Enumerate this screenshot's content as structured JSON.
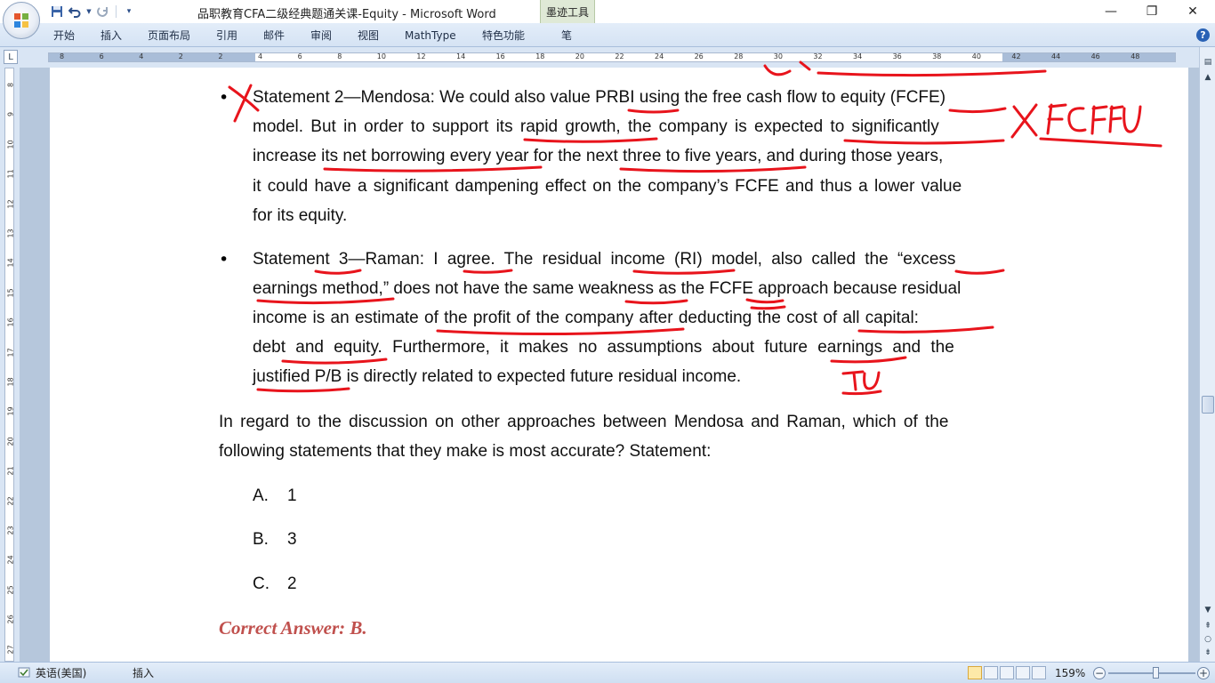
{
  "window": {
    "title": "品职教育CFA二级经典题通关课-Equity - Microsoft Word",
    "context_tab": "墨迹工具",
    "minimize": "—",
    "restore": "❐",
    "close": "✕"
  },
  "qat": {
    "save_icon": "save-icon",
    "undo_icon": "undo-icon",
    "redo_icon": "redo-icon",
    "customize_icon": "customize-icon"
  },
  "ribbon": {
    "tabs": [
      "开始",
      "插入",
      "页面布局",
      "引用",
      "邮件",
      "审阅",
      "视图",
      "MathType",
      "特色功能",
      "笔"
    ],
    "help": "?"
  },
  "ruler": {
    "corner": "L",
    "h_numbers": [
      "8",
      "6",
      "4",
      "2",
      "2",
      "4",
      "6",
      "8",
      "10",
      "12",
      "14",
      "16",
      "18",
      "20",
      "22",
      "24",
      "26",
      "28",
      "30",
      "32",
      "34",
      "36",
      "38",
      "40",
      "42",
      "44",
      "46",
      "48"
    ],
    "v_numbers": [
      "8",
      "9",
      "10",
      "11",
      "12",
      "13",
      "14",
      "15",
      "16",
      "17",
      "18",
      "19",
      "20",
      "21",
      "22",
      "23",
      "24",
      "25",
      "26",
      "27"
    ]
  },
  "document": {
    "statement2_lines": [
      "Statement 2—Mendosa: We could also value PRBI using the free cash flow to equity (FCFE)",
      "model. But in order to support its rapid growth, the company is expected to significantly",
      "increase its net borrowing every year for the next three to five years, and during those years,",
      "it could have a significant dampening effect on the company’s FCFE and thus a lower value",
      "for its equity."
    ],
    "statement3_lines": [
      "Statement 3—Raman: I agree. The residual income (RI) model, also called the “excess",
      "earnings method,” does not have the same weakness as the FCFE approach because residual",
      "income is an estimate of the profit of the company after deducting the cost of all capital:",
      "debt and equity. Furthermore, it makes no assumptions about future earnings and the",
      "justified P/B is directly related to expected future residual income."
    ],
    "question_lines": [
      "In regard to the discussion on other approaches between Mendosa and Raman, which of the",
      "following statements that they make is most accurate? Statement:"
    ],
    "options": [
      {
        "letter": "A.",
        "value": "1"
      },
      {
        "letter": "B.",
        "value": "3"
      },
      {
        "letter": "C.",
        "value": "2"
      }
    ],
    "answer": "Correct Answer: B.",
    "bullet": "•",
    "ink_annotations": [
      "FCFFU",
      "TU"
    ]
  },
  "statusbar": {
    "language": "英语(美国)",
    "insert_mode": "插入",
    "zoom": "159%",
    "zoom_out": "−",
    "zoom_in": "+"
  },
  "colors": {
    "ink": "#e8141c",
    "answer": "#c0504d",
    "ribbon_bg": "#dbe7f6"
  }
}
